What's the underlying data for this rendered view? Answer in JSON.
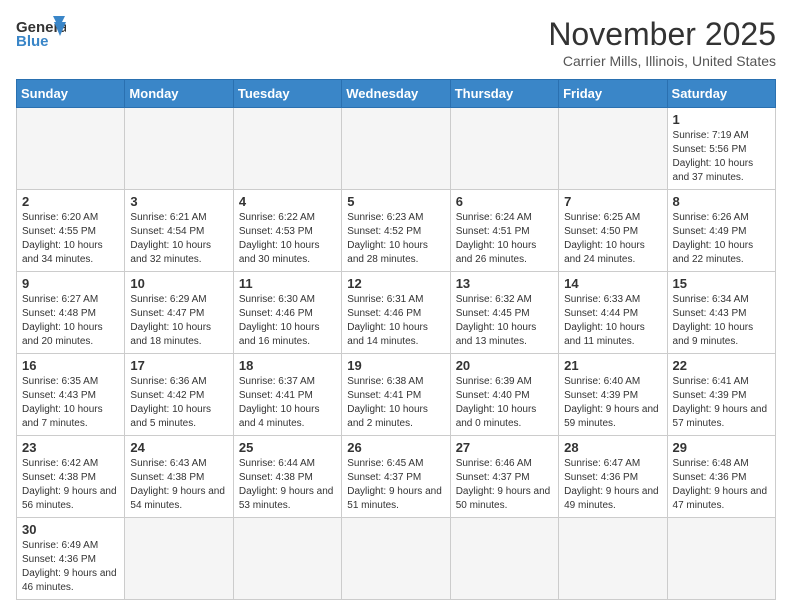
{
  "header": {
    "logo_general": "General",
    "logo_blue": "Blue",
    "month_title": "November 2025",
    "location": "Carrier Mills, Illinois, United States"
  },
  "days_of_week": [
    "Sunday",
    "Monday",
    "Tuesday",
    "Wednesday",
    "Thursday",
    "Friday",
    "Saturday"
  ],
  "weeks": [
    [
      {
        "day": "",
        "info": ""
      },
      {
        "day": "",
        "info": ""
      },
      {
        "day": "",
        "info": ""
      },
      {
        "day": "",
        "info": ""
      },
      {
        "day": "",
        "info": ""
      },
      {
        "day": "",
        "info": ""
      },
      {
        "day": "1",
        "info": "Sunrise: 7:19 AM\nSunset: 5:56 PM\nDaylight: 10 hours and 37 minutes."
      }
    ],
    [
      {
        "day": "2",
        "info": "Sunrise: 6:20 AM\nSunset: 4:55 PM\nDaylight: 10 hours and 34 minutes."
      },
      {
        "day": "3",
        "info": "Sunrise: 6:21 AM\nSunset: 4:54 PM\nDaylight: 10 hours and 32 minutes."
      },
      {
        "day": "4",
        "info": "Sunrise: 6:22 AM\nSunset: 4:53 PM\nDaylight: 10 hours and 30 minutes."
      },
      {
        "day": "5",
        "info": "Sunrise: 6:23 AM\nSunset: 4:52 PM\nDaylight: 10 hours and 28 minutes."
      },
      {
        "day": "6",
        "info": "Sunrise: 6:24 AM\nSunset: 4:51 PM\nDaylight: 10 hours and 26 minutes."
      },
      {
        "day": "7",
        "info": "Sunrise: 6:25 AM\nSunset: 4:50 PM\nDaylight: 10 hours and 24 minutes."
      },
      {
        "day": "8",
        "info": "Sunrise: 6:26 AM\nSunset: 4:49 PM\nDaylight: 10 hours and 22 minutes."
      }
    ],
    [
      {
        "day": "9",
        "info": "Sunrise: 6:27 AM\nSunset: 4:48 PM\nDaylight: 10 hours and 20 minutes."
      },
      {
        "day": "10",
        "info": "Sunrise: 6:29 AM\nSunset: 4:47 PM\nDaylight: 10 hours and 18 minutes."
      },
      {
        "day": "11",
        "info": "Sunrise: 6:30 AM\nSunset: 4:46 PM\nDaylight: 10 hours and 16 minutes."
      },
      {
        "day": "12",
        "info": "Sunrise: 6:31 AM\nSunset: 4:46 PM\nDaylight: 10 hours and 14 minutes."
      },
      {
        "day": "13",
        "info": "Sunrise: 6:32 AM\nSunset: 4:45 PM\nDaylight: 10 hours and 13 minutes."
      },
      {
        "day": "14",
        "info": "Sunrise: 6:33 AM\nSunset: 4:44 PM\nDaylight: 10 hours and 11 minutes."
      },
      {
        "day": "15",
        "info": "Sunrise: 6:34 AM\nSunset: 4:43 PM\nDaylight: 10 hours and 9 minutes."
      }
    ],
    [
      {
        "day": "16",
        "info": "Sunrise: 6:35 AM\nSunset: 4:43 PM\nDaylight: 10 hours and 7 minutes."
      },
      {
        "day": "17",
        "info": "Sunrise: 6:36 AM\nSunset: 4:42 PM\nDaylight: 10 hours and 5 minutes."
      },
      {
        "day": "18",
        "info": "Sunrise: 6:37 AM\nSunset: 4:41 PM\nDaylight: 10 hours and 4 minutes."
      },
      {
        "day": "19",
        "info": "Sunrise: 6:38 AM\nSunset: 4:41 PM\nDaylight: 10 hours and 2 minutes."
      },
      {
        "day": "20",
        "info": "Sunrise: 6:39 AM\nSunset: 4:40 PM\nDaylight: 10 hours and 0 minutes."
      },
      {
        "day": "21",
        "info": "Sunrise: 6:40 AM\nSunset: 4:39 PM\nDaylight: 9 hours and 59 minutes."
      },
      {
        "day": "22",
        "info": "Sunrise: 6:41 AM\nSunset: 4:39 PM\nDaylight: 9 hours and 57 minutes."
      }
    ],
    [
      {
        "day": "23",
        "info": "Sunrise: 6:42 AM\nSunset: 4:38 PM\nDaylight: 9 hours and 56 minutes."
      },
      {
        "day": "24",
        "info": "Sunrise: 6:43 AM\nSunset: 4:38 PM\nDaylight: 9 hours and 54 minutes."
      },
      {
        "day": "25",
        "info": "Sunrise: 6:44 AM\nSunset: 4:38 PM\nDaylight: 9 hours and 53 minutes."
      },
      {
        "day": "26",
        "info": "Sunrise: 6:45 AM\nSunset: 4:37 PM\nDaylight: 9 hours and 51 minutes."
      },
      {
        "day": "27",
        "info": "Sunrise: 6:46 AM\nSunset: 4:37 PM\nDaylight: 9 hours and 50 minutes."
      },
      {
        "day": "28",
        "info": "Sunrise: 6:47 AM\nSunset: 4:36 PM\nDaylight: 9 hours and 49 minutes."
      },
      {
        "day": "29",
        "info": "Sunrise: 6:48 AM\nSunset: 4:36 PM\nDaylight: 9 hours and 47 minutes."
      }
    ],
    [
      {
        "day": "30",
        "info": "Sunrise: 6:49 AM\nSunset: 4:36 PM\nDaylight: 9 hours and 46 minutes."
      },
      {
        "day": "",
        "info": ""
      },
      {
        "day": "",
        "info": ""
      },
      {
        "day": "",
        "info": ""
      },
      {
        "day": "",
        "info": ""
      },
      {
        "day": "",
        "info": ""
      },
      {
        "day": "",
        "info": ""
      }
    ]
  ]
}
